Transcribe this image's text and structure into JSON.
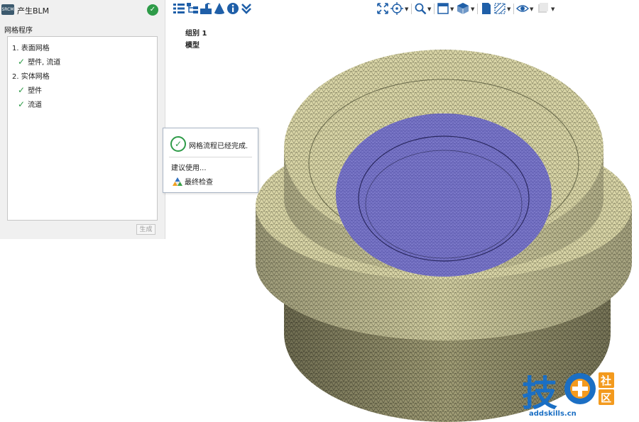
{
  "panel": {
    "app_icon_text": "SRCM",
    "title": "产生BLM",
    "section_label": "网格程序",
    "items": [
      {
        "label": "1. 表面网格",
        "checked": false
      },
      {
        "label": "塑件, 流道",
        "checked": true
      },
      {
        "label": "2. 实体网格",
        "checked": false
      },
      {
        "label": "塑件",
        "checked": true
      },
      {
        "label": "流道",
        "checked": true
      }
    ],
    "generate_label": "生成"
  },
  "popup": {
    "message": "网格流程已经完成.",
    "suggest": "建议使用...",
    "final_check": "最终检查"
  },
  "viewport": {
    "group_label": "组别 1",
    "model_label": "模型"
  },
  "watermark": {
    "site": "addskills.cn",
    "glyph_main": "技",
    "glyph_top": "社",
    "glyph_bottom": "区"
  },
  "colors": {
    "check_green": "#2e9b48",
    "toolbar_blue": "#1f5fa8",
    "mesh_tan": "#d8d4a6",
    "mesh_purple": "#7b78c8",
    "watermark_blue": "#1b6fc4",
    "watermark_orange": "#f39a1e"
  }
}
